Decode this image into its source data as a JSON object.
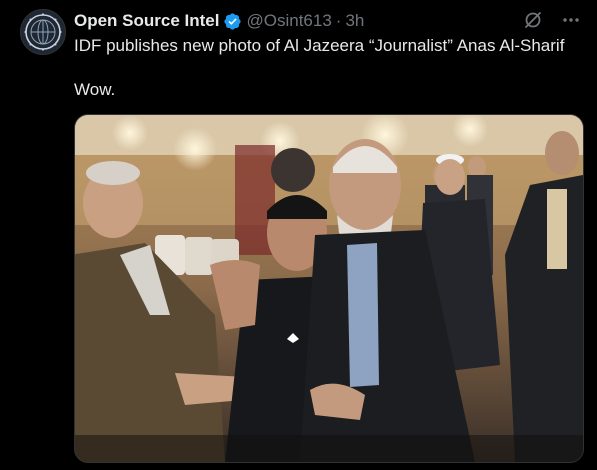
{
  "author": {
    "name": "Open Source Intel",
    "handle": "@Osint613",
    "separator": "·",
    "time": "3h",
    "avatar_icon": "globe-emblem-icon",
    "verified_icon": "verified-badge-icon",
    "verified_color": "#1d9bf0"
  },
  "tweet": {
    "text_line1": "IDF publishes new photo of Al Jazeera “Journalist” Anas Al-Sharif",
    "text_line2": "Wow."
  },
  "actions": {
    "grok_icon": "grok-icon",
    "more_icon": "more-icon"
  },
  "media": {
    "type": "photo",
    "content": "group of men posing indoors, several smiling"
  },
  "colors": {
    "background": "#000000",
    "text": "#e7e9ea",
    "muted": "#71767b",
    "border": "#2f3336"
  }
}
